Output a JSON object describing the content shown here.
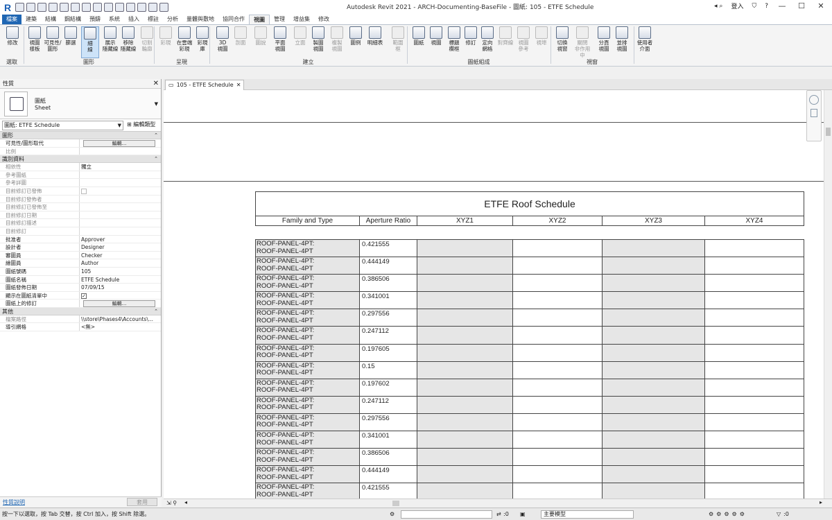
{
  "window_title": "Autodesk Revit 2021 - ARCH-Documenting-BaseFile - 圖紙: 105 - ETFE Schedule",
  "user": "登入",
  "ribbon_tabs": [
    "檔案",
    "建築",
    "結構",
    "鋼結構",
    "預鑄",
    "系統",
    "插入",
    "標註",
    "分析",
    "量體與敷地",
    "協同合作",
    "視圖",
    "管理",
    "增益集",
    "修改"
  ],
  "ribbon_buttons": [
    {
      "label": "修改",
      "dis": false,
      "sel": false
    },
    {
      "label": "視圖\n樣板",
      "dis": false,
      "sel": false
    },
    {
      "label": "可見性/\n圖形",
      "dis": false,
      "sel": false
    },
    {
      "label": "篩選",
      "dis": false,
      "sel": false
    },
    {
      "label": "細\n線",
      "dis": false,
      "sel": true
    },
    {
      "label": "展示\n隱藏線",
      "dis": false,
      "sel": false
    },
    {
      "label": "移除\n隱藏線",
      "dis": false,
      "sel": false
    },
    {
      "label": "切割\n輪廓",
      "dis": true,
      "sel": false
    },
    {
      "label": "彩現",
      "dis": true,
      "sel": false
    },
    {
      "label": "在雲端\n彩現",
      "dis": false,
      "sel": false
    },
    {
      "label": "彩現\n庫",
      "dis": false,
      "sel": false
    },
    {
      "label": "3D\n視圖",
      "dis": false,
      "sel": false
    },
    {
      "label": "剖面",
      "dis": true,
      "sel": false
    },
    {
      "label": "圖說",
      "dis": true,
      "sel": false
    },
    {
      "label": "平面\n視圖",
      "dis": false,
      "sel": false
    },
    {
      "label": "立面",
      "dis": true,
      "sel": false
    },
    {
      "label": "製圖\n視圖",
      "dis": false,
      "sel": false
    },
    {
      "label": "複製\n視圖",
      "dis": true,
      "sel": false
    },
    {
      "label": "圖例",
      "dis": false,
      "sel": false
    },
    {
      "label": "明細表",
      "dis": false,
      "sel": false
    },
    {
      "label": "範圍\n框",
      "dis": true,
      "sel": false
    },
    {
      "label": "圖紙",
      "dis": false,
      "sel": false
    },
    {
      "label": "視圖",
      "dis": false,
      "sel": false
    },
    {
      "label": "標題\n欄框",
      "dis": false,
      "sel": false
    },
    {
      "label": "修訂",
      "dis": false,
      "sel": false
    },
    {
      "label": "定向\n網格",
      "dis": false,
      "sel": false
    },
    {
      "label": "對齊線",
      "dis": true,
      "sel": false
    },
    {
      "label": "視圖\n參考",
      "dis": true,
      "sel": false
    },
    {
      "label": "視埠",
      "dis": true,
      "sel": false
    },
    {
      "label": "切換\n視窗",
      "dis": false,
      "sel": false
    },
    {
      "label": "關閉\n非作用中",
      "dis": true,
      "sel": false
    },
    {
      "label": "分頁\n視圖",
      "dis": false,
      "sel": false
    },
    {
      "label": "並排\n視圖",
      "dis": false,
      "sel": false
    },
    {
      "label": "使用者\n介面",
      "dis": false,
      "sel": false
    }
  ],
  "ribbon_groups": [
    "選取",
    "圖形",
    "呈現",
    "建立",
    "圖紙組成",
    "視窗"
  ],
  "properties": {
    "title": "性質",
    "type_name": "圖紙",
    "type_sub": "Sheet",
    "filter": "圖紙: ETFE Schedule",
    "edit_type": "編輯類型",
    "sections": [
      {
        "name": "圖形",
        "rows": [
          {
            "k": "可見性/圖形取代",
            "v": "",
            "btn": "編輯...",
            "grey": false
          },
          {
            "k": "比例",
            "v": "",
            "grey": true
          }
        ]
      },
      {
        "name": "識別資料",
        "rows": [
          {
            "k": "相依性",
            "v": "獨立",
            "grey": true
          },
          {
            "k": "參考圖紙",
            "v": "",
            "grey": true
          },
          {
            "k": "參考詳圖",
            "v": "",
            "grey": true
          },
          {
            "k": "目前修訂已發佈",
            "v": "",
            "chk": "dis",
            "grey": true
          },
          {
            "k": "目前修訂發佈者",
            "v": "",
            "grey": true
          },
          {
            "k": "目前修訂已發佈至",
            "v": "",
            "grey": true
          },
          {
            "k": "目前修訂日期",
            "v": "",
            "grey": true
          },
          {
            "k": "目前修訂描述",
            "v": "",
            "grey": true
          },
          {
            "k": "目前修訂",
            "v": "",
            "grey": true
          },
          {
            "k": "批准者",
            "v": "Approver",
            "grey": false
          },
          {
            "k": "設計者",
            "v": "Designer",
            "grey": false
          },
          {
            "k": "審圖員",
            "v": "Checker",
            "grey": false
          },
          {
            "k": "繪圖員",
            "v": "Author",
            "grey": false
          },
          {
            "k": "圖紙號碼",
            "v": "105",
            "grey": false
          },
          {
            "k": "圖紙名稱",
            "v": "ETFE Schedule",
            "grey": false
          },
          {
            "k": "圖紙發佈日期",
            "v": "07/09/15",
            "grey": false
          },
          {
            "k": "顯示在圖紙清單中",
            "v": "",
            "chk": "on",
            "grey": false
          },
          {
            "k": "圖紙上的修訂",
            "v": "",
            "btn": "編輯...",
            "grey": false
          }
        ]
      },
      {
        "name": "其他",
        "rows": [
          {
            "k": "檔案路徑",
            "v": "\\\\store\\Phases4\\Accounts\\...",
            "grey": true
          },
          {
            "k": "導引網格",
            "v": "<無>",
            "grey": false
          }
        ]
      }
    ],
    "help_link": "性質說明",
    "apply": "套用"
  },
  "view_tab": "105 - ETFE Schedule",
  "schedule": {
    "title": "ETFE Roof Schedule",
    "columns": [
      "Family and Type",
      "Aperture Ratio",
      "XYZ1",
      "XYZ2",
      "XYZ3",
      "XYZ4"
    ],
    "rows": [
      {
        "fam": "ROOF-PANEL-4PT:\nROOF-PANEL-4PT",
        "ap": "0.421555"
      },
      {
        "fam": "ROOF-PANEL-4PT:\nROOF-PANEL-4PT",
        "ap": "0.444149"
      },
      {
        "fam": "ROOF-PANEL-4PT:\nROOF-PANEL-4PT",
        "ap": "0.386506"
      },
      {
        "fam": "ROOF-PANEL-4PT:\nROOF-PANEL-4PT",
        "ap": "0.341001"
      },
      {
        "fam": "ROOF-PANEL-4PT:\nROOF-PANEL-4PT",
        "ap": "0.297556"
      },
      {
        "fam": "ROOF-PANEL-4PT:\nROOF-PANEL-4PT",
        "ap": "0.247112"
      },
      {
        "fam": "ROOF-PANEL-4PT:\nROOF-PANEL-4PT",
        "ap": "0.197605"
      },
      {
        "fam": "ROOF-PANEL-4PT:\nROOF-PANEL-4PT",
        "ap": "0.15"
      },
      {
        "fam": "ROOF-PANEL-4PT:\nROOF-PANEL-4PT",
        "ap": "0.197602"
      },
      {
        "fam": "ROOF-PANEL-4PT:\nROOF-PANEL-4PT",
        "ap": "0.247112"
      },
      {
        "fam": "ROOF-PANEL-4PT:\nROOF-PANEL-4PT",
        "ap": "0.297556"
      },
      {
        "fam": "ROOF-PANEL-4PT:\nROOF-PANEL-4PT",
        "ap": "0.341001"
      },
      {
        "fam": "ROOF-PANEL-4PT:\nROOF-PANEL-4PT",
        "ap": "0.386506"
      },
      {
        "fam": "ROOF-PANEL-4PT:\nROOF-PANEL-4PT",
        "ap": "0.444149"
      },
      {
        "fam": "ROOF-PANEL-4PT:\nROOF-PANEL-4PT",
        "ap": "0.421555"
      }
    ]
  },
  "status": {
    "message": "按一下以選取，按 Tab 交替，按 Ctrl 加入，按 Shift 除選。",
    "count_a": ":0",
    "model": "主要模型",
    "filter_count": ":0"
  },
  "colors": {
    "accent": "#1f66b3",
    "grey_cell": "#e6e6e6"
  }
}
